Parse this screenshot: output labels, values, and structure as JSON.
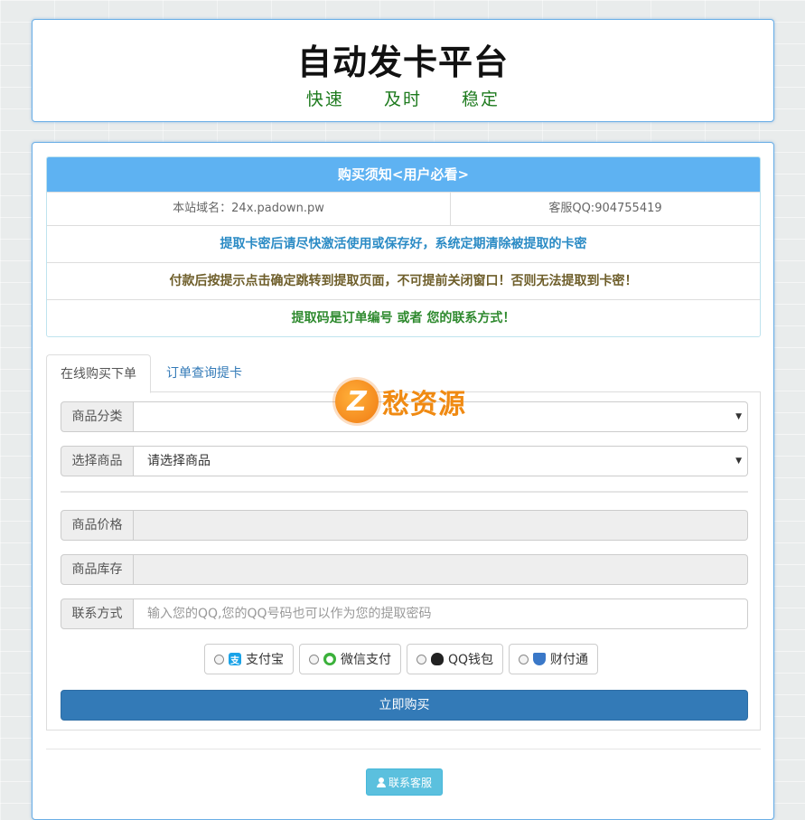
{
  "header": {
    "title": "自动发卡平台",
    "slogan": [
      "快速",
      "及时",
      "稳定"
    ]
  },
  "notice": {
    "title": "购买须知<用户必看>",
    "domain": "本站域名：24x.padown.pw",
    "qq": "客服QQ:904755419",
    "lines": [
      "提取卡密后请尽快激活使用或保存好，系统定期清除被提取的卡密",
      "付款后按提示点击确定跳转到提取页面，不可提前关闭窗口！否则无法提取到卡密！",
      "提取码是订单编号 或者 您的联系方式！"
    ],
    "colors": {
      "title_bg": "#5eb2f2",
      "line1": "#2b8bc5",
      "line2": "#6e5e2a",
      "line3": "#2f8a2f"
    }
  },
  "tabs": [
    {
      "label": "在线购买下单",
      "active": true
    },
    {
      "label": "订单查询提卡",
      "active": false
    }
  ],
  "form": {
    "category": {
      "label": "商品分类",
      "value": ""
    },
    "product": {
      "label": "选择商品",
      "value": "请选择商品"
    },
    "price": {
      "label": "商品价格",
      "value": ""
    },
    "stock": {
      "label": "商品库存",
      "value": ""
    },
    "contact": {
      "label": "联系方式",
      "placeholder": "输入您的QQ,您的QQ号码也可以作为您的提取密码"
    }
  },
  "payment_options": [
    {
      "label": "支付宝",
      "icon": "alipay-icon"
    },
    {
      "label": "微信支付",
      "icon": "wechat-icon"
    },
    {
      "label": "QQ钱包",
      "icon": "qq-wallet-icon"
    },
    {
      "label": "财付通",
      "icon": "tenpay-icon"
    }
  ],
  "buy_button": "立即购买",
  "service_button": "联系客服",
  "watermark": {
    "logo_letter": "Z",
    "text": "愁资源"
  }
}
